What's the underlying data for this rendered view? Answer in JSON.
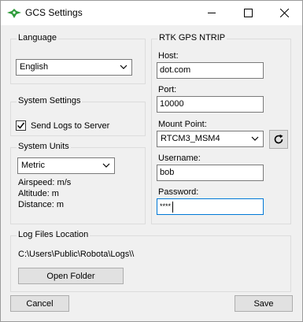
{
  "window": {
    "title": "GCS Settings",
    "icon": "drone-icon"
  },
  "language": {
    "group_label": "Language",
    "selected": "English"
  },
  "system_settings": {
    "group_label": "System Settings",
    "send_logs_label": "Send Logs to Server",
    "send_logs_checked": true
  },
  "system_units": {
    "group_label": "System Units",
    "selected": "Metric",
    "airspeed": "Airspeed: m/s",
    "altitude": "Altitude: m",
    "distance": "Distance: m"
  },
  "rtk": {
    "group_label": "RTK GPS NTRIP",
    "host_label": "Host:",
    "host_value": "dot.com",
    "port_label": "Port:",
    "port_value": "10000",
    "mount_label": "Mount Point:",
    "mount_value": "RTCM3_MSM4",
    "username_label": "Username:",
    "username_value": "bob",
    "password_label": "Password:",
    "password_value": "****"
  },
  "log_files": {
    "group_label": "Log Files Location",
    "path": "C:\\Users\\Public\\Robota\\Logs\\\\",
    "open_folder_label": "Open Folder"
  },
  "footer": {
    "cancel_label": "Cancel",
    "save_label": "Save"
  },
  "colors": {
    "accent": "#0078d7",
    "icon_green": "#2e9b3a"
  }
}
